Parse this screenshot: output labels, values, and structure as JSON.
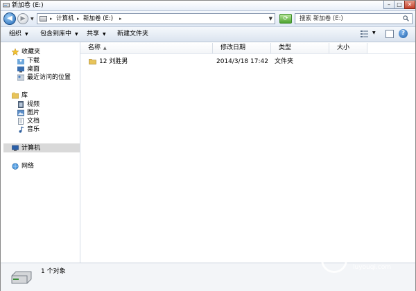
{
  "window": {
    "title": "新加卷 (E:)",
    "controls": {
      "minimize": "–",
      "maximize": "□",
      "close": "✕"
    }
  },
  "address_bar": {
    "segments": [
      "计算机",
      "新加卷 (E:)"
    ],
    "separator": "▸"
  },
  "search": {
    "placeholder": "搜索 新加卷 (E:)"
  },
  "toolbar": {
    "organize": "组织",
    "include_in_library": "包含到库中",
    "share": "共享",
    "new_folder": "新建文件夹"
  },
  "nav_pane": {
    "favorites": {
      "label": "收藏夹",
      "items": [
        "下载",
        "桌面",
        "最近访问的位置"
      ]
    },
    "libraries": {
      "label": "库",
      "items": [
        "视频",
        "图片",
        "文档",
        "音乐"
      ]
    },
    "computer": "计算机",
    "network": "网络"
  },
  "columns": [
    "名称",
    "修改日期",
    "类型",
    "大小"
  ],
  "rows": [
    {
      "name": "12 刘胜男",
      "modified": "2014/3/18 17:42",
      "type": "文件夹",
      "size": ""
    }
  ],
  "status": {
    "count_text": "1 个对象"
  },
  "watermark": {
    "text": "路由器",
    "sub": "luyouqi.com"
  },
  "colors": {
    "accent": "#1f66b5",
    "selected": "#d9d9d9",
    "folder": "#e8c45a"
  }
}
